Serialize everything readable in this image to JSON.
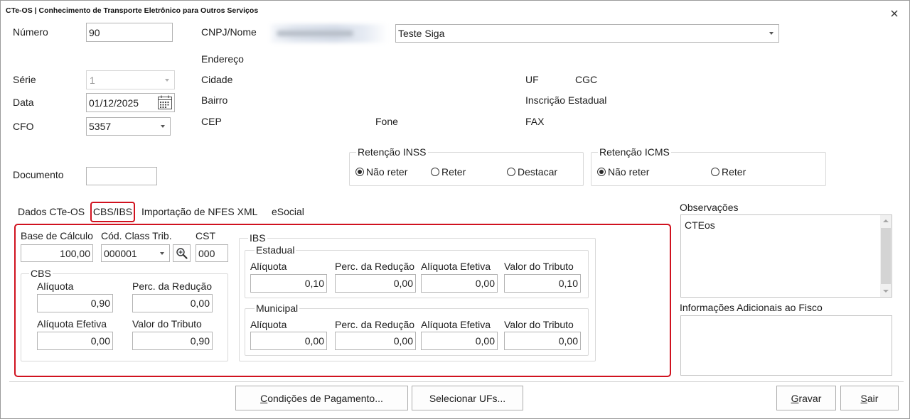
{
  "window": {
    "title": "CTe-OS | Conhecimento de Transporte Eletrônico para Outros Serviços"
  },
  "header": {
    "numero": {
      "label": "Número",
      "value": "90"
    },
    "cnpj_nome": {
      "label": "CNPJ/Nome",
      "nome": "Teste Siga"
    },
    "serie": {
      "label": "Série",
      "value": "1",
      "disabled": true
    },
    "data": {
      "label": "Data",
      "value": "01/12/2025"
    },
    "cfo": {
      "label": "CFO",
      "value": "5357"
    },
    "documento": {
      "label": "Documento",
      "value": ""
    }
  },
  "address": {
    "endereco": "Endereço",
    "cidade": "Cidade",
    "uf": "UF",
    "cgc": "CGC",
    "bairro": "Bairro",
    "inscricao_estadual": "Inscrição Estadual",
    "cep": "CEP",
    "fone": "Fone",
    "fax": "FAX"
  },
  "retencao_inss": {
    "title": "Retenção INSS",
    "options": [
      {
        "label": "Não reter",
        "checked": true
      },
      {
        "label": "Reter",
        "checked": false
      },
      {
        "label": "Destacar",
        "checked": false
      }
    ]
  },
  "retencao_icms": {
    "title": "Retenção ICMS",
    "options": [
      {
        "label": "Não reter",
        "checked": true
      },
      {
        "label": "Reter",
        "checked": false
      }
    ]
  },
  "tabs": [
    {
      "label": "Dados CTe-OS",
      "selected": false
    },
    {
      "label": "CBS/IBS",
      "selected": true
    },
    {
      "label": "Importação de NFES XML",
      "selected": false
    },
    {
      "label": "eSocial",
      "selected": false
    }
  ],
  "cbs_ibs": {
    "base_calculo": {
      "label": "Base de Cálculo",
      "value": "100,00"
    },
    "cod_class_trib": {
      "label": "Cód. Class Trib.",
      "value": "000001"
    },
    "cst": {
      "label": "CST",
      "value": "000"
    },
    "cbs": {
      "title": "CBS",
      "aliquota": {
        "label": "Alíquota",
        "value": "0,90"
      },
      "perc_reducao": {
        "label": "Perc. da Redução",
        "value": "0,00"
      },
      "aliquota_efetiva": {
        "label": "Alíquota Efetiva",
        "value": "0,00"
      },
      "valor_tributo": {
        "label": "Valor do Tributo",
        "value": "0,90"
      }
    },
    "ibs": {
      "title": "IBS",
      "estadual": {
        "title": "Estadual",
        "aliquota": {
          "label": "Alíquota",
          "value": "0,10"
        },
        "perc_reducao": {
          "label": "Perc. da Redução",
          "value": "0,00"
        },
        "aliquota_efetiva": {
          "label": "Alíquota Efetiva",
          "value": "0,00"
        },
        "valor_tributo": {
          "label": "Valor do Tributo",
          "value": "0,10"
        }
      },
      "municipal": {
        "title": "Municipal",
        "aliquota": {
          "label": "Alíquota",
          "value": "0,00"
        },
        "perc_reducao": {
          "label": "Perc. da Redução",
          "value": "0,00"
        },
        "aliquota_efetiva": {
          "label": "Alíquota Efetiva",
          "value": "0,00"
        },
        "valor_tributo": {
          "label": "Valor do Tributo",
          "value": "0,00"
        }
      }
    }
  },
  "observacoes": {
    "label": "Observações",
    "value": "CTEos"
  },
  "info_fisco": {
    "label": "Informações Adicionais ao Fisco",
    "value": ""
  },
  "buttons": {
    "condicoes_pagamento": "Condições de Pagamento...",
    "selecionar_ufs": "Selecionar UFs...",
    "gravar": "Gravar",
    "sair": "Sair"
  },
  "icons": {
    "close": "close-icon",
    "dropdown": "chevron-down-icon",
    "calendar": "calendar-icon",
    "search": "search-icon",
    "scroll_up": "scroll-up-icon",
    "scroll_down": "scroll-down-icon"
  },
  "colors": {
    "highlight": "#d0121f",
    "text": "#1e1e1e",
    "input_border": "#b4b4b4",
    "group_border": "#d9d9d9"
  }
}
